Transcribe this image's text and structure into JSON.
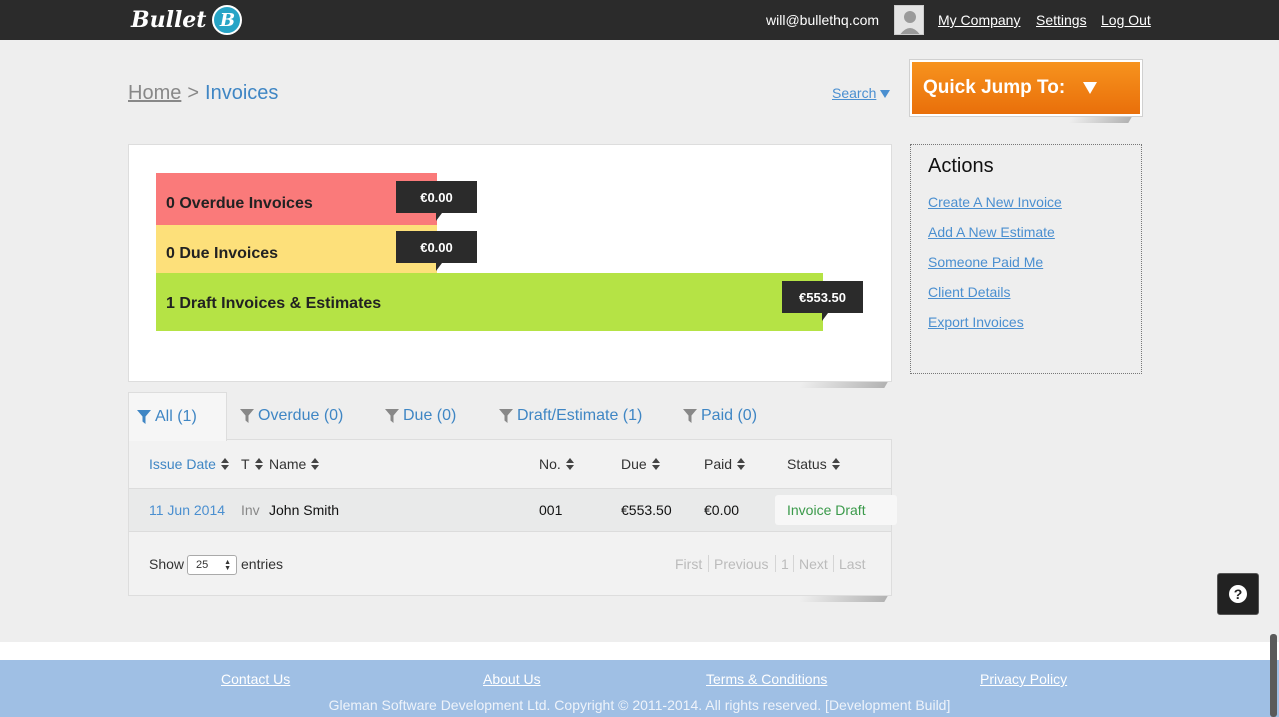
{
  "header": {
    "logo_text": "Bullet",
    "logo_badge": "B",
    "user_email": "will@bullethq.com",
    "links": [
      "My Company",
      "Settings",
      "Log Out"
    ]
  },
  "breadcrumb": {
    "home": "Home",
    "separator": ">",
    "current": "Invoices"
  },
  "search_label": "Search",
  "quick_jump_label": "Quick Jump To:",
  "summary": {
    "overdue": {
      "label": "0 Overdue Invoices",
      "amount": "€0.00",
      "color": "#fa7a7a"
    },
    "due": {
      "label": "0 Due Invoices",
      "amount": "€0.00",
      "color": "#fde07a"
    },
    "draft": {
      "label": "1 Draft Invoices & Estimates",
      "amount": "€553.50",
      "color": "#b5e345"
    }
  },
  "actions": {
    "title": "Actions",
    "items": [
      "Create A New Invoice",
      "Add A New Estimate",
      "Someone Paid Me",
      "Client Details",
      "Export Invoices"
    ]
  },
  "tabs": [
    {
      "label": "All (1)",
      "active": true
    },
    {
      "label": "Overdue (0)",
      "active": false
    },
    {
      "label": "Due (0)",
      "active": false
    },
    {
      "label": "Draft/Estimate (1)",
      "active": false
    },
    {
      "label": "Paid (0)",
      "active": false
    }
  ],
  "table": {
    "columns": [
      "Issue Date",
      "T",
      "Name",
      "No.",
      "Due",
      "Paid",
      "Status"
    ],
    "rows": [
      {
        "issue_date": "11 Jun 2014",
        "type": "Inv",
        "name": "John Smith",
        "number": "001",
        "due": "€553.50",
        "paid": "€0.00",
        "status": "Invoice Draft"
      }
    ],
    "show_label": "Show",
    "entries_label": "entries",
    "page_size": "25",
    "pager": [
      "First",
      "Previous",
      "1",
      "Next",
      "Last"
    ]
  },
  "help_icon": "question-icon",
  "footer": {
    "links": [
      "Contact Us",
      "About Us",
      "Terms & Conditions",
      "Privacy Policy"
    ],
    "copyright": "Gleman Software Development Ltd. Copyright © 2011-2014. All rights reserved. [Development Build]"
  },
  "colors": {
    "topbar": "#2b2b2b",
    "accent_blue": "#3f86c4",
    "quick_jump_orange": "#f7931e",
    "status_green": "#3a9a4a",
    "footer_blue": "#9fbfe4"
  }
}
